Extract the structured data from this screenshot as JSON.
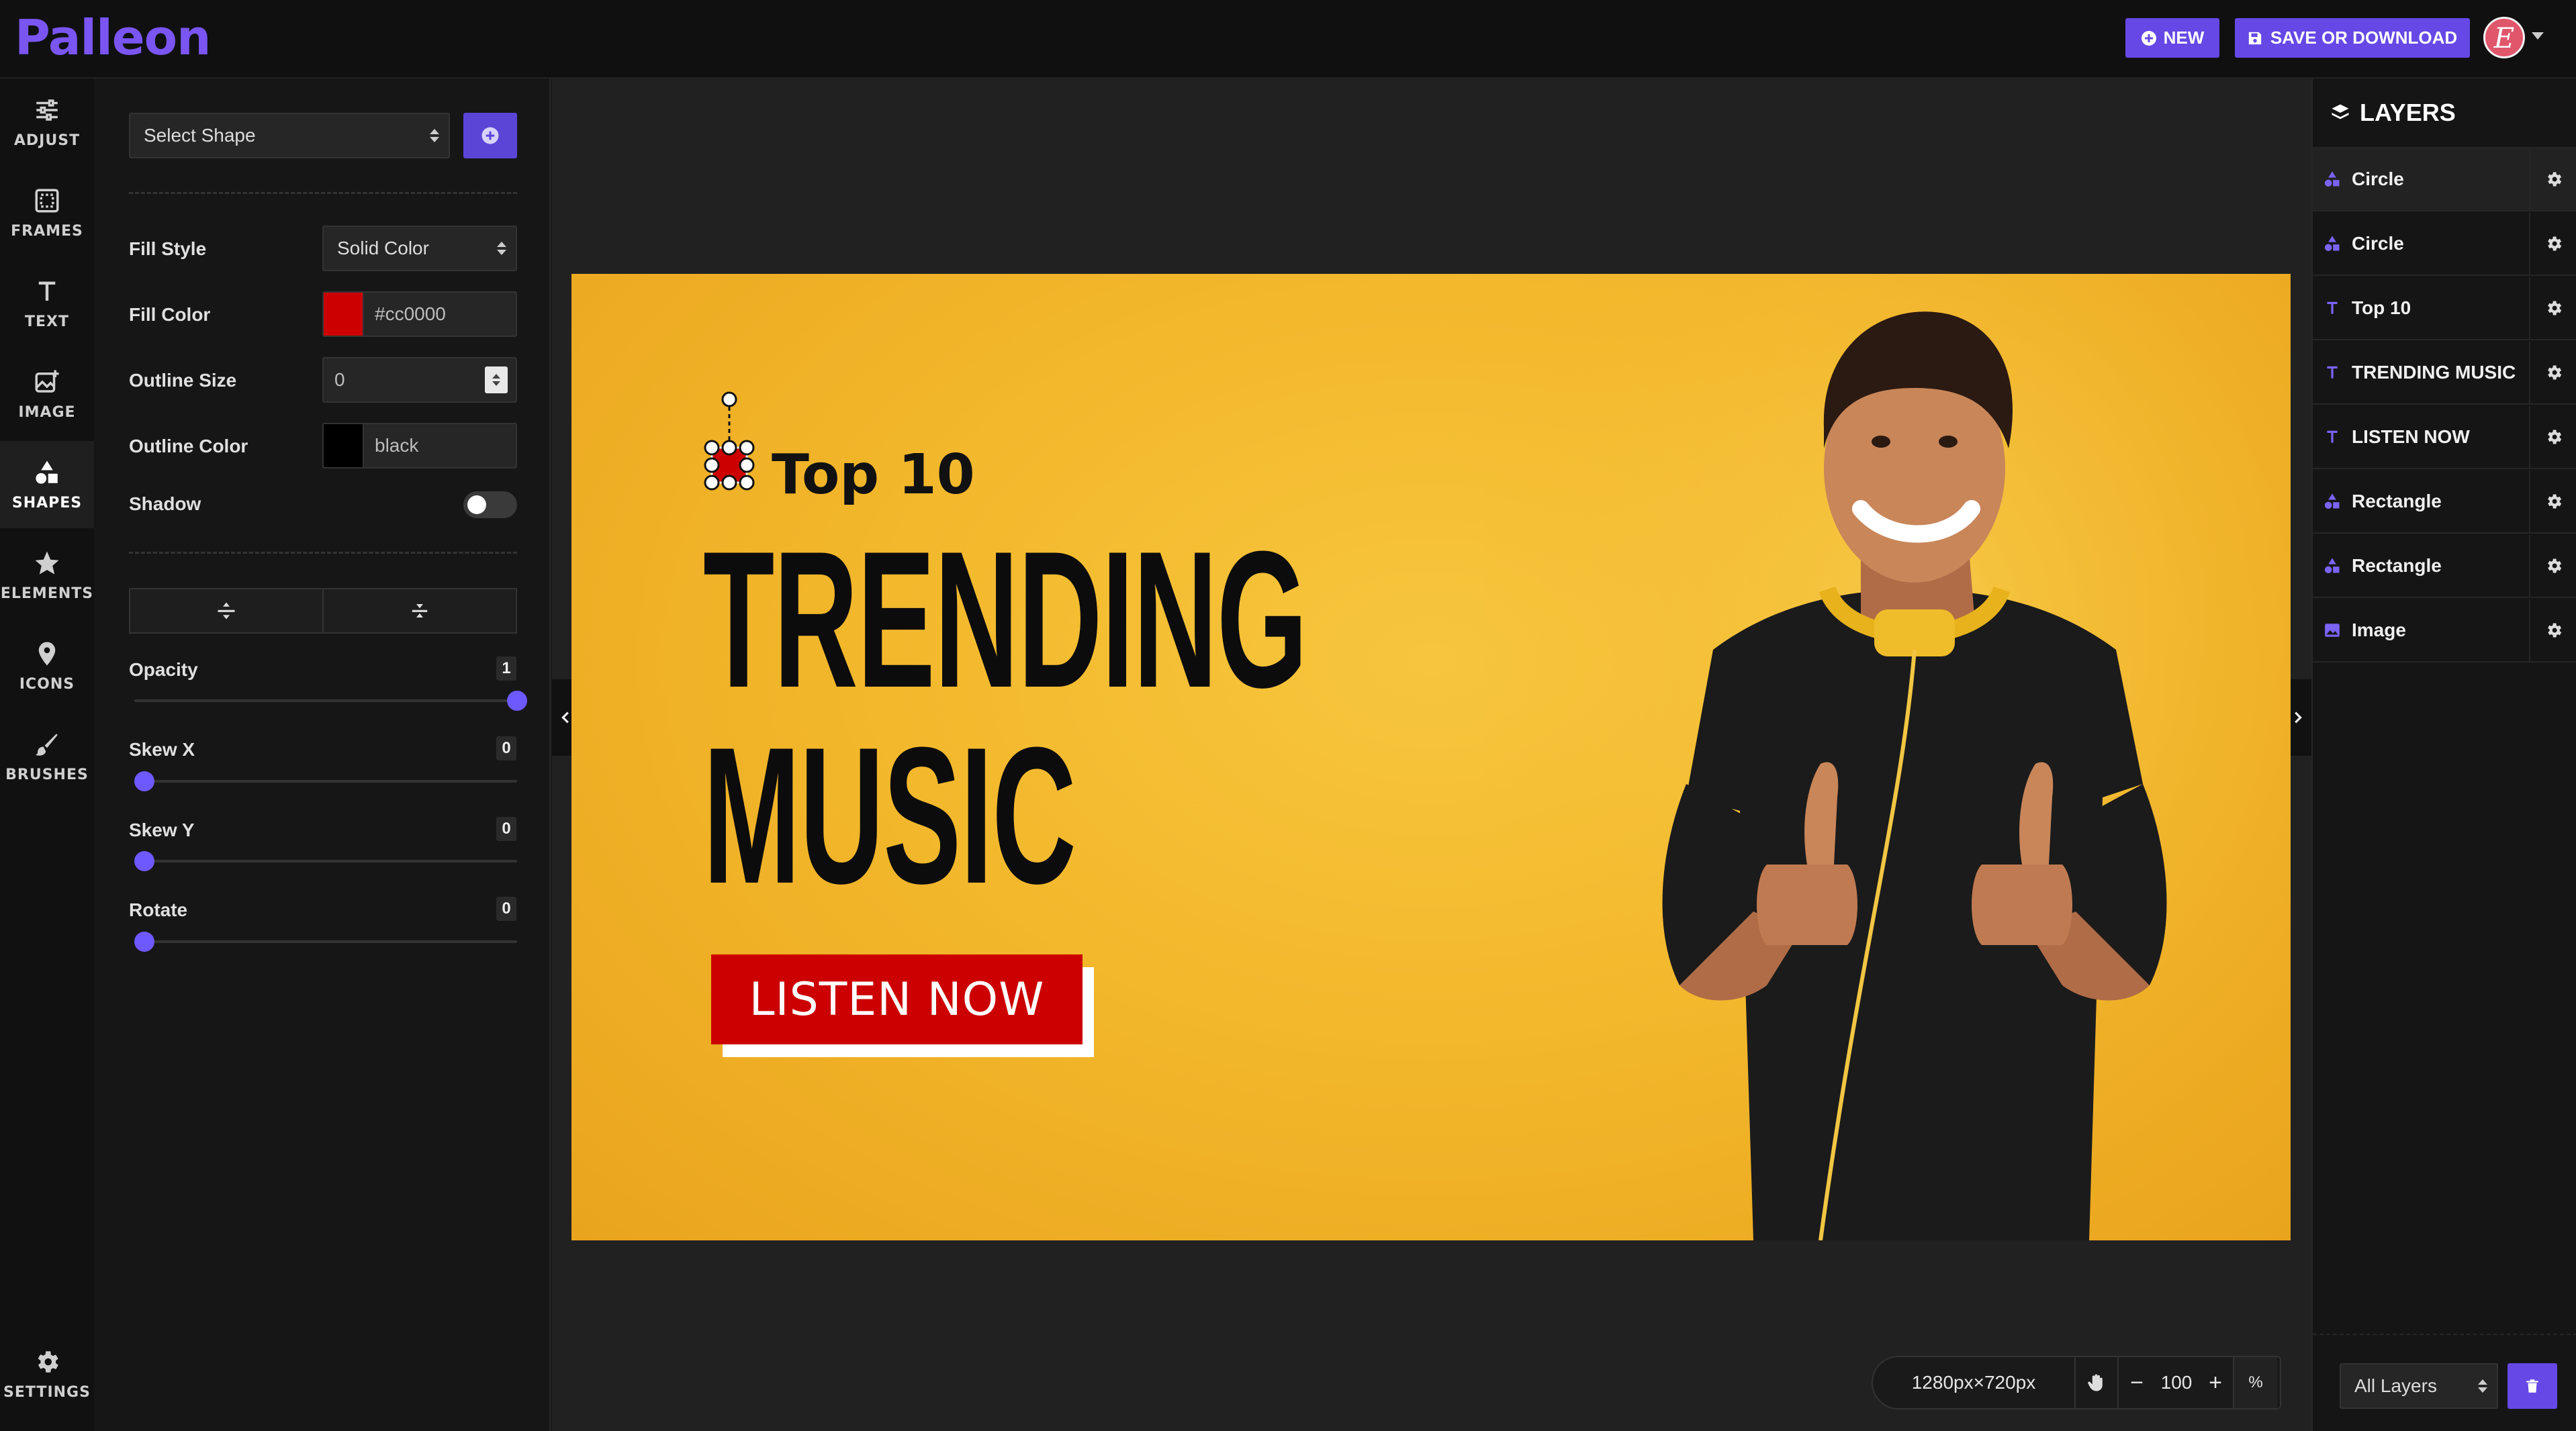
{
  "app": {
    "logo": "Palleon",
    "new_label": "NEW",
    "save_label": "SAVE OR DOWNLOAD",
    "avatar_initial": "E",
    "accent": "#6648e6"
  },
  "nav": [
    {
      "label": "ADJUST",
      "icon": "sliders-icon"
    },
    {
      "label": "FRAMES",
      "icon": "frame-icon"
    },
    {
      "label": "TEXT",
      "icon": "text-icon"
    },
    {
      "label": "IMAGE",
      "icon": "image-add-icon"
    },
    {
      "label": "SHAPES",
      "icon": "shapes-icon",
      "active": true
    },
    {
      "label": "ELEMENTS",
      "icon": "star-icon"
    },
    {
      "label": "ICONS",
      "icon": "map-pin-icon"
    },
    {
      "label": "BRUSHES",
      "icon": "brush-icon"
    },
    {
      "label": "SETTINGS",
      "icon": "gear-icon"
    }
  ],
  "shape_panel": {
    "select_shape_placeholder": "Select Shape",
    "fill_style_label": "Fill Style",
    "fill_style_value": "Solid Color",
    "fill_color_label": "Fill Color",
    "fill_color_value": "#cc0000",
    "outline_size_label": "Outline Size",
    "outline_size_value": "0",
    "outline_color_label": "Outline Color",
    "outline_color_value": "black",
    "shadow_label": "Shadow",
    "shadow_on": false,
    "opacity_label": "Opacity",
    "opacity_value": "1",
    "skew_x_label": "Skew X",
    "skew_x_value": "0",
    "skew_y_label": "Skew Y",
    "skew_y_value": "0",
    "rotate_label": "Rotate",
    "rotate_value": "0"
  },
  "artwork": {
    "top10": "Top 10",
    "trending": "TRENDING",
    "music": "MUSIC",
    "cta": "LISTEN NOW",
    "background_color": "#f3b82c",
    "cta_color": "#cc0000"
  },
  "zoom": {
    "dimensions": "1280px×720px",
    "minus": "−",
    "level": "100",
    "plus": "+",
    "unit": "%"
  },
  "layers": {
    "title": "LAYERS",
    "items": [
      {
        "name": "Circle",
        "type": "shape",
        "active": true
      },
      {
        "name": "Circle",
        "type": "shape"
      },
      {
        "name": "Top 10",
        "type": "text"
      },
      {
        "name": "TRENDING MUSIC",
        "type": "text"
      },
      {
        "name": "LISTEN NOW",
        "type": "text"
      },
      {
        "name": "Rectangle",
        "type": "shape"
      },
      {
        "name": "Rectangle",
        "type": "shape"
      },
      {
        "name": "Image",
        "type": "image"
      }
    ],
    "filter_value": "All Layers"
  }
}
